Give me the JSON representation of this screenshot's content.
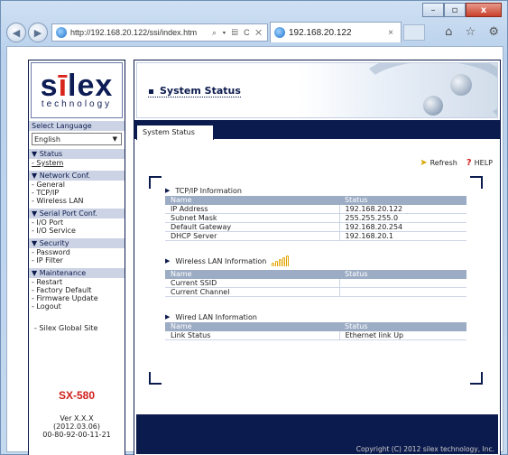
{
  "browser": {
    "url": "http://192.168.20.122/ssi/index.htm",
    "tab_title": "192.168.20.122",
    "address_tools": "⌕ ▾ ▤ C ✕",
    "tab_close": "×",
    "right_icons": "⌂ ☆ ⚙",
    "min": "–",
    "max": "▫",
    "close": "x"
  },
  "logo": {
    "main_left": "s",
    "main_dot": "ī",
    "main_right": "lex",
    "sub": "technology"
  },
  "language": {
    "label": "Select Language",
    "selected": "English"
  },
  "menu": {
    "status": {
      "head": "▼ Status",
      "items": [
        "- System"
      ]
    },
    "network": {
      "head": "▼ Network Conf.",
      "items": [
        "- General",
        "- TCP/IP",
        "- Wireless LAN"
      ]
    },
    "serial": {
      "head": "▼ Serial Port Conf.",
      "items": [
        "- I/O Port",
        "- I/O Service"
      ]
    },
    "security": {
      "head": "▼ Security",
      "items": [
        "- Password",
        "- IP Filter"
      ]
    },
    "maintenance": {
      "head": "▼ Maintenance",
      "items": [
        "- Restart",
        "- Factory Default",
        "- Firmware Update",
        "- Logout"
      ]
    },
    "global": "- Silex Global Site"
  },
  "device": {
    "model": "SX-580",
    "ver": "Ver X.X.X",
    "date": "(2012.03.06)",
    "mac": "00-80-92-00-11-21"
  },
  "header": {
    "title": "System Status",
    "tab": "System Status"
  },
  "actions": {
    "refresh": "Refresh",
    "help": "HELP"
  },
  "tcpip": {
    "title": "TCP/IP Information",
    "headers": [
      "Name",
      "Status"
    ],
    "rows": [
      [
        "IP Address",
        "192.168.20.122"
      ],
      [
        "Subnet Mask",
        "255.255.255.0"
      ],
      [
        "Default Gateway",
        "192.168.20.254"
      ],
      [
        "DHCP Server",
        "192.168.20.1"
      ]
    ]
  },
  "wlan": {
    "title": "Wireless LAN Information",
    "headers": [
      "Name",
      "Status"
    ],
    "rows": [
      [
        "Current SSID",
        ""
      ],
      [
        "Current Channel",
        ""
      ]
    ]
  },
  "wired": {
    "title": "Wired LAN Information",
    "headers": [
      "Name",
      "Status"
    ],
    "rows": [
      [
        "Link Status",
        "Ethernet link Up"
      ]
    ]
  },
  "footer": {
    "copyright": "Copyright (C) 2012 silex technology, Inc."
  }
}
